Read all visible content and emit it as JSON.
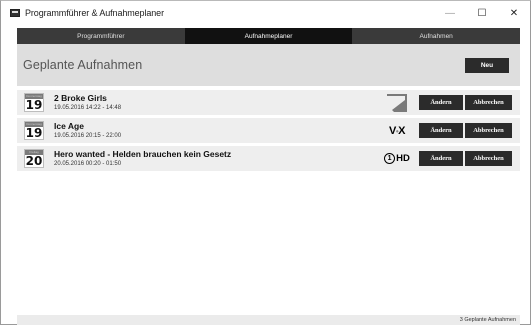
{
  "window": {
    "title": "Programmführer & Aufnahmeplaner",
    "controls": {
      "minimize": "—",
      "maximize": "☐",
      "close": "✕"
    }
  },
  "tabs": [
    {
      "label": "Programmführer",
      "active": false
    },
    {
      "label": "Aufnahmeplaner",
      "active": true
    },
    {
      "label": "Aufnahmen",
      "active": false
    }
  ],
  "header": {
    "title": "Geplante Aufnahmen",
    "new_button": "Neu"
  },
  "recordings": [
    {
      "cal_label": "Donnerstag",
      "day": "19",
      "title": "2 Broke Girls",
      "time": "19.05.2016 14:22 - 14:48",
      "channel": "ProSieben",
      "channel_icon": "prosieben-logo"
    },
    {
      "cal_label": "Donnerstag",
      "day": "19",
      "title": "Ice Age",
      "time": "19.05.2016 20:15 - 22:00",
      "channel": "VOX",
      "channel_icon": "vox-logo"
    },
    {
      "cal_label": "Freitag",
      "day": "20",
      "title": "Hero wanted - Helden brauchen kein Gesetz",
      "time": "20.05.2016 00:20 - 01:50",
      "channel": "Das Erste HD",
      "channel_icon": "ard-hd-logo"
    }
  ],
  "row_buttons": {
    "edit": "Ändern",
    "cancel": "Abbrechen"
  },
  "status": {
    "text": "3 Geplante Aufnahmen"
  },
  "colors": {
    "tab_active": "#111111",
    "tab_inactive": "#3a3a3a",
    "header_bg": "#dedede",
    "row_bg": "#eeeeee",
    "button": "#2b2b2b"
  }
}
